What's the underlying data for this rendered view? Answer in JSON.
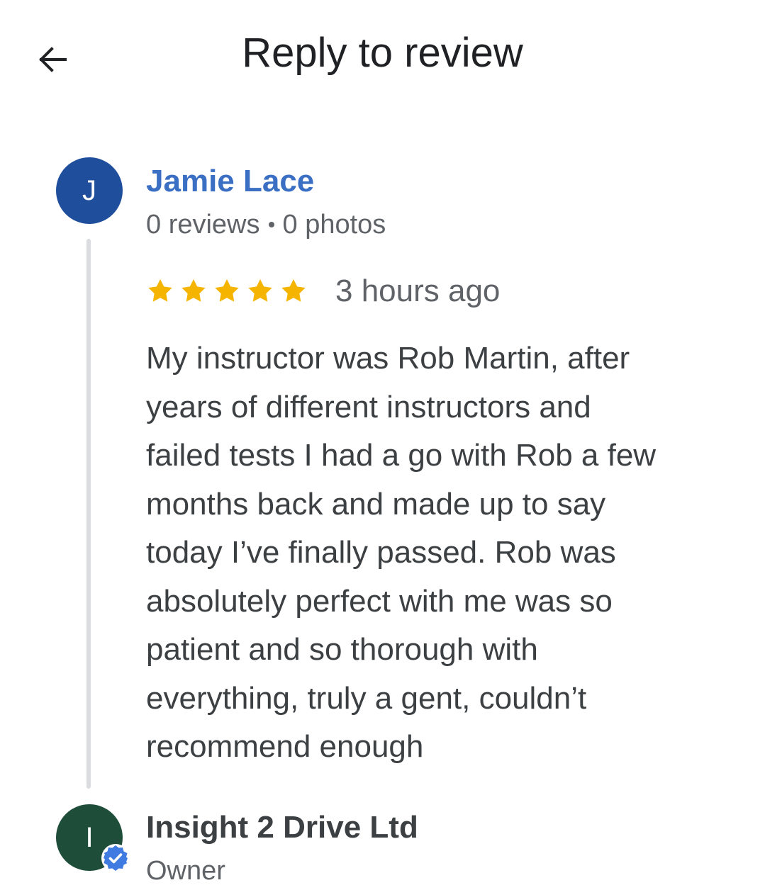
{
  "header": {
    "title": "Reply to review",
    "back_icon": "arrow-left-icon"
  },
  "reviewer": {
    "initial": "J",
    "name": "Jamie Lace",
    "reviews_count": "0 reviews",
    "photos_count": "0 photos",
    "rating": 5,
    "rating_max": 5,
    "time": "3 hours ago",
    "review_lines": [
      "My instructor was Rob Martin, after",
      "years of different instructors and",
      "failed tests I had a go with Rob a few",
      "months back and made up to say",
      "today I’ve finally passed. Rob was",
      "absolutely perfect with me was so",
      "patient and so thorough with",
      "everything, truly a gent, couldn’t",
      "recommend enough"
    ]
  },
  "owner": {
    "initial": "I",
    "name": "Insight 2 Drive Ltd",
    "role": "Owner",
    "badge_icon": "verified-badge-icon"
  },
  "colors": {
    "reviewer_avatar": "#1f4f9c",
    "owner_avatar": "#1e4d3a",
    "reviewer_name": "#3a6fc4",
    "star": "#f4b400",
    "verified": "#3f7be0"
  }
}
